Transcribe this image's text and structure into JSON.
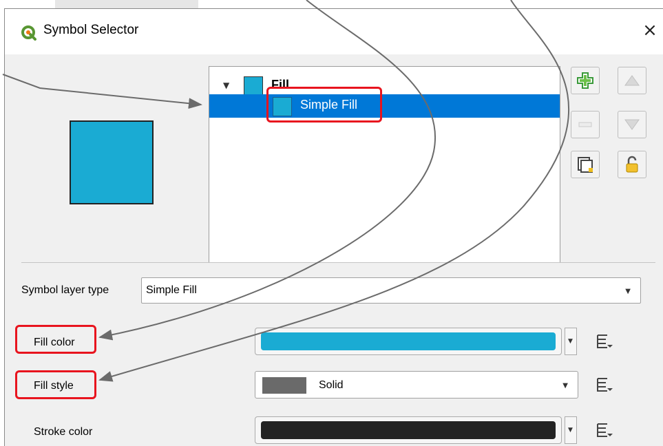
{
  "window": {
    "title": "Symbol Selector",
    "close_symbol": "×",
    "title_icon": "qgis-logo-icon"
  },
  "preview": {
    "color": "#1aabd3"
  },
  "tree": {
    "items": [
      {
        "label": "Fill",
        "level": 0,
        "expanded": true,
        "swatch": "#1aabd3"
      },
      {
        "label": "Simple Fill",
        "level": 1,
        "selected": true,
        "swatch": "#1aabd3"
      }
    ]
  },
  "toolbar": {
    "add_icon": "add-layer-icon",
    "up_icon": "move-up-icon",
    "remove_icon": "remove-layer-icon",
    "down_icon": "move-down-icon",
    "duplicate_icon": "duplicate-layer-icon",
    "lock_icon": "unlock-icon"
  },
  "symbol_layer_type": {
    "label": "Symbol layer type",
    "value": "Simple Fill"
  },
  "properties": {
    "fill_color": {
      "label": "Fill color",
      "color": "#1aabd3"
    },
    "fill_style": {
      "label": "Fill style",
      "value": "Solid",
      "swatch": "#6a6a6a"
    },
    "stroke_color": {
      "label": "Stroke color",
      "color": "#232323"
    }
  },
  "annotations": {
    "highlight_color": "#e8141e",
    "arrow_color": "#6b6b6b"
  }
}
